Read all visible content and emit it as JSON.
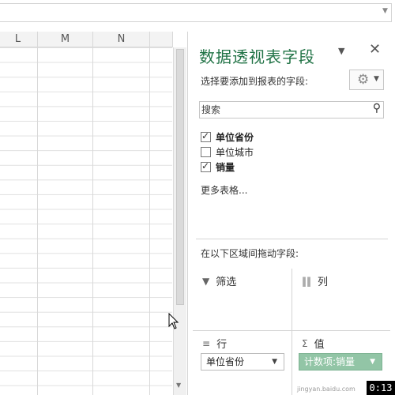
{
  "columns": [
    "L",
    "M",
    "N"
  ],
  "panel": {
    "title": "数据透视表字段",
    "subtitle": "选择要添加到报表的字段:",
    "search_placeholder": "搜索",
    "fields": [
      {
        "label": "单位省份",
        "checked": true
      },
      {
        "label": "单位城市",
        "checked": false
      },
      {
        "label": "销量",
        "checked": true
      }
    ],
    "more_tables": "更多表格...",
    "area_hint": "在以下区域间拖动字段:",
    "areas": {
      "filter": "筛选",
      "columns": "列",
      "rows": "行",
      "values": "值"
    },
    "row_pill": "单位省份",
    "value_pill": "计数项:销量",
    "icons": {
      "menu": "chevron-down-icon",
      "close": "close-icon",
      "settings": "gear-icon",
      "search": "search-icon",
      "filter": "filter-icon",
      "columns": "columns-icon",
      "rows": "rows-icon",
      "values": "sigma-icon"
    },
    "accent_color": "#217346",
    "value_pill_color": "#92c5a6"
  },
  "overlay": {
    "timer": "0:13",
    "watermark": "jingyan.baidu.com"
  }
}
